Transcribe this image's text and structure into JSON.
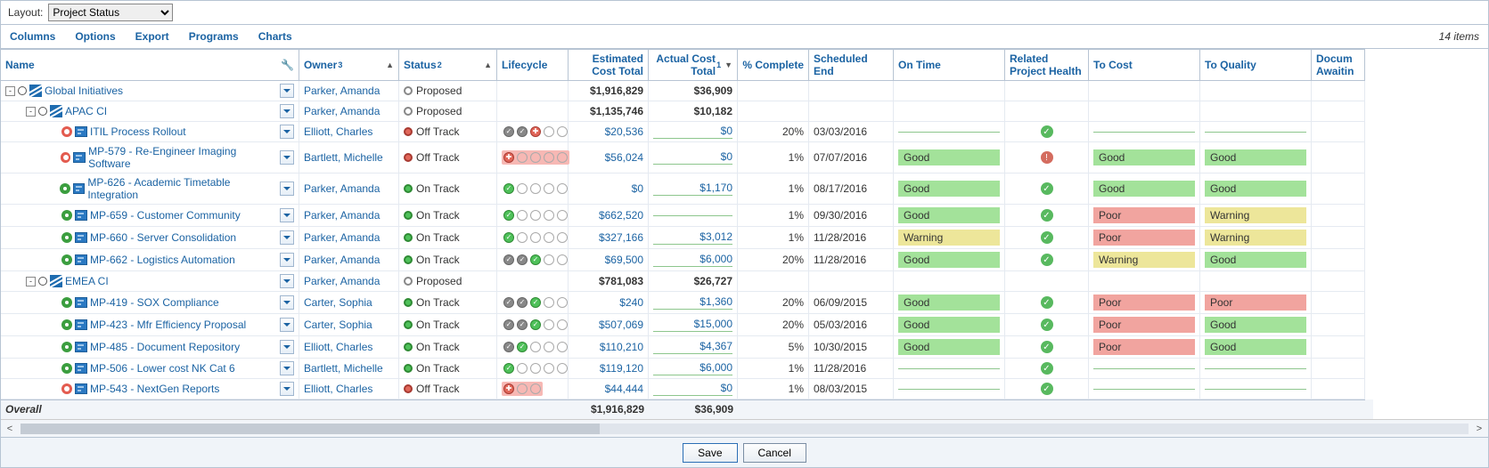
{
  "layout": {
    "label": "Layout:",
    "options": [
      "Project Status"
    ],
    "selected": "Project Status"
  },
  "toolbar": {
    "columns": "Columns",
    "options": "Options",
    "export": "Export",
    "programs": "Programs",
    "charts": "Charts",
    "count": "14 items"
  },
  "headers": {
    "name": "Name",
    "owner": "Owner",
    "owner_sup": "3",
    "status": "Status",
    "status_sup": "2",
    "lifecycle": "Lifecycle",
    "est": "Estimated Cost Total",
    "act": "Actual Cost Total",
    "act_sup": "1",
    "pct": "% Complete",
    "sched": "Scheduled End",
    "ontime": "On Time",
    "health": "Related Project Health",
    "tocost": "To Cost",
    "toqual": "To Quality",
    "docaw": "Docum Awaitin"
  },
  "rows": [
    {
      "id": "r0",
      "level": 0,
      "expand": "-",
      "icon": "program",
      "health": null,
      "name": "Global Initiatives",
      "owner": "Parker, Amanda",
      "statusIcon": "empty",
      "status": "Proposed",
      "life": [],
      "est": "$1,916,829",
      "estBold": true,
      "act": "$36,909",
      "actBold": true,
      "pct": "",
      "sched": "",
      "ontime": "",
      "hpcheck": "",
      "tocost": "",
      "toqual": ""
    },
    {
      "id": "r1",
      "level": 1,
      "expand": "-",
      "icon": "program",
      "health": null,
      "name": "APAC CI",
      "owner": "Parker, Amanda",
      "statusIcon": "empty",
      "status": "Proposed",
      "life": [],
      "est": "$1,135,746",
      "estBold": true,
      "act": "$10,182",
      "actBold": true,
      "pct": "",
      "sched": "",
      "ontime": "",
      "hpcheck": "",
      "tocost": "",
      "toqual": ""
    },
    {
      "id": "r2",
      "level": 2,
      "expand": "",
      "icon": "project",
      "health": "red",
      "name": "ITIL Process Rollout",
      "owner": "Elliott, Charles",
      "statusIcon": "red",
      "status": "Off Track",
      "life": [
        "check-grey",
        "check-grey",
        "red-cross",
        "empty",
        "empty"
      ],
      "est": "$20,536",
      "act": "$0",
      "pct": "20%",
      "sched": "03/03/2016",
      "ontime": "",
      "hpcheck": "ok",
      "tocost": "",
      "toqual": ""
    },
    {
      "id": "r3",
      "level": 2,
      "expand": "",
      "icon": "project",
      "health": "red",
      "name": "MP-579 - Re-Engineer Imaging Software",
      "owner": "Bartlett, Michelle",
      "statusIcon": "red",
      "status": "Off Track",
      "life": [
        "red-cross",
        "empty",
        "empty",
        "empty",
        "empty"
      ],
      "lifeRed": true,
      "est": "$56,024",
      "act": "$0",
      "pct": "1%",
      "sched": "07/07/2016",
      "ontime": "Good",
      "hpcheck": "alert",
      "tocost": "Good",
      "toqual": "Good"
    },
    {
      "id": "r4",
      "level": 2,
      "expand": "",
      "icon": "project",
      "health": "green",
      "name": "MP-626 - Academic Timetable Integration",
      "owner": "Parker, Amanda",
      "statusIcon": "green",
      "status": "On Track",
      "life": [
        "check-green",
        "empty",
        "empty",
        "empty",
        "empty"
      ],
      "est": "$0",
      "act": "$1,170",
      "pct": "1%",
      "sched": "08/17/2016",
      "ontime": "Good",
      "hpcheck": "ok",
      "tocost": "Good",
      "toqual": "Good"
    },
    {
      "id": "r5",
      "level": 2,
      "expand": "",
      "icon": "project",
      "health": "green",
      "name": "MP-659 - Customer Community",
      "owner": "Parker, Amanda",
      "statusIcon": "green",
      "status": "On Track",
      "life": [
        "check-green",
        "empty",
        "empty",
        "empty",
        "empty"
      ],
      "est": "$662,520",
      "act": "",
      "pct": "1%",
      "sched": "09/30/2016",
      "ontime": "Good",
      "hpcheck": "ok",
      "tocost": "Poor",
      "toqual": "Warning"
    },
    {
      "id": "r6",
      "level": 2,
      "expand": "",
      "icon": "project",
      "health": "green",
      "name": "MP-660 - Server Consolidation",
      "owner": "Parker, Amanda",
      "statusIcon": "green",
      "status": "On Track",
      "life": [
        "check-green",
        "empty",
        "empty",
        "empty",
        "empty"
      ],
      "est": "$327,166",
      "act": "$3,012",
      "pct": "1%",
      "sched": "11/28/2016",
      "ontime": "Warning",
      "hpcheck": "ok",
      "tocost": "Poor",
      "toqual": "Warning"
    },
    {
      "id": "r7",
      "level": 2,
      "expand": "",
      "icon": "project",
      "health": "green",
      "name": "MP-662 - Logistics Automation",
      "owner": "Parker, Amanda",
      "statusIcon": "green",
      "status": "On Track",
      "life": [
        "check-grey",
        "check-grey",
        "check-green",
        "empty",
        "empty"
      ],
      "est": "$69,500",
      "act": "$6,000",
      "pct": "20%",
      "sched": "11/28/2016",
      "ontime": "Good",
      "hpcheck": "ok",
      "tocost": "Warning",
      "toqual": "Good"
    },
    {
      "id": "r8",
      "level": 1,
      "expand": "-",
      "icon": "program",
      "health": null,
      "name": "EMEA CI",
      "owner": "Parker, Amanda",
      "statusIcon": "empty",
      "status": "Proposed",
      "life": [],
      "est": "$781,083",
      "estBold": true,
      "act": "$26,727",
      "actBold": true,
      "pct": "",
      "sched": "",
      "ontime": "",
      "hpcheck": "",
      "tocost": "",
      "toqual": ""
    },
    {
      "id": "r9",
      "level": 2,
      "expand": "",
      "icon": "project",
      "health": "green",
      "name": "MP-419 - SOX Compliance",
      "owner": "Carter, Sophia",
      "statusIcon": "green",
      "status": "On Track",
      "life": [
        "check-grey",
        "check-grey",
        "check-green",
        "empty",
        "empty"
      ],
      "est": "$240",
      "act": "$1,360",
      "pct": "20%",
      "sched": "06/09/2015",
      "ontime": "Good",
      "hpcheck": "ok",
      "tocost": "Poor",
      "toqual": "Poor"
    },
    {
      "id": "r10",
      "level": 2,
      "expand": "",
      "icon": "project",
      "health": "green",
      "name": "MP-423 - Mfr Efficiency Proposal",
      "owner": "Carter, Sophia",
      "statusIcon": "green",
      "status": "On Track",
      "life": [
        "check-grey",
        "check-grey",
        "check-green",
        "empty",
        "empty"
      ],
      "est": "$507,069",
      "act": "$15,000",
      "pct": "20%",
      "sched": "05/03/2016",
      "ontime": "Good",
      "hpcheck": "ok",
      "tocost": "Poor",
      "toqual": "Good"
    },
    {
      "id": "r11",
      "level": 2,
      "expand": "",
      "icon": "project",
      "health": "green",
      "name": "MP-485 - Document Repository",
      "owner": "Elliott, Charles",
      "statusIcon": "green",
      "status": "On Track",
      "life": [
        "check-grey",
        "check-green",
        "empty",
        "empty",
        "empty"
      ],
      "est": "$110,210",
      "act": "$4,367",
      "pct": "5%",
      "sched": "10/30/2015",
      "ontime": "Good",
      "hpcheck": "ok",
      "tocost": "Poor",
      "toqual": "Good"
    },
    {
      "id": "r12",
      "level": 2,
      "expand": "",
      "icon": "project",
      "health": "green",
      "name": "MP-506 - Lower cost NK Cat 6",
      "owner": "Bartlett, Michelle",
      "statusIcon": "green",
      "status": "On Track",
      "life": [
        "check-green",
        "empty",
        "empty",
        "empty",
        "empty"
      ],
      "est": "$119,120",
      "act": "$6,000",
      "pct": "1%",
      "sched": "11/28/2016",
      "ontime": "",
      "hpcheck": "ok",
      "tocost": "",
      "toqual": ""
    },
    {
      "id": "r13",
      "level": 2,
      "expand": "",
      "icon": "project",
      "health": "red",
      "name": "MP-543 - NextGen Reports",
      "owner": "Elliott, Charles",
      "statusIcon": "red",
      "status": "Off Track",
      "life": [
        "red-cross",
        "empty",
        "empty"
      ],
      "lifeRed": true,
      "est": "$44,444",
      "act": "$0",
      "pct": "1%",
      "sched": "08/03/2015",
      "ontime": "",
      "hpcheck": "ok",
      "tocost": "",
      "toqual": ""
    }
  ],
  "footer": {
    "label": "Overall",
    "est": "$1,916,829",
    "act": "$36,909"
  },
  "buttons": {
    "save": "Save",
    "cancel": "Cancel"
  }
}
